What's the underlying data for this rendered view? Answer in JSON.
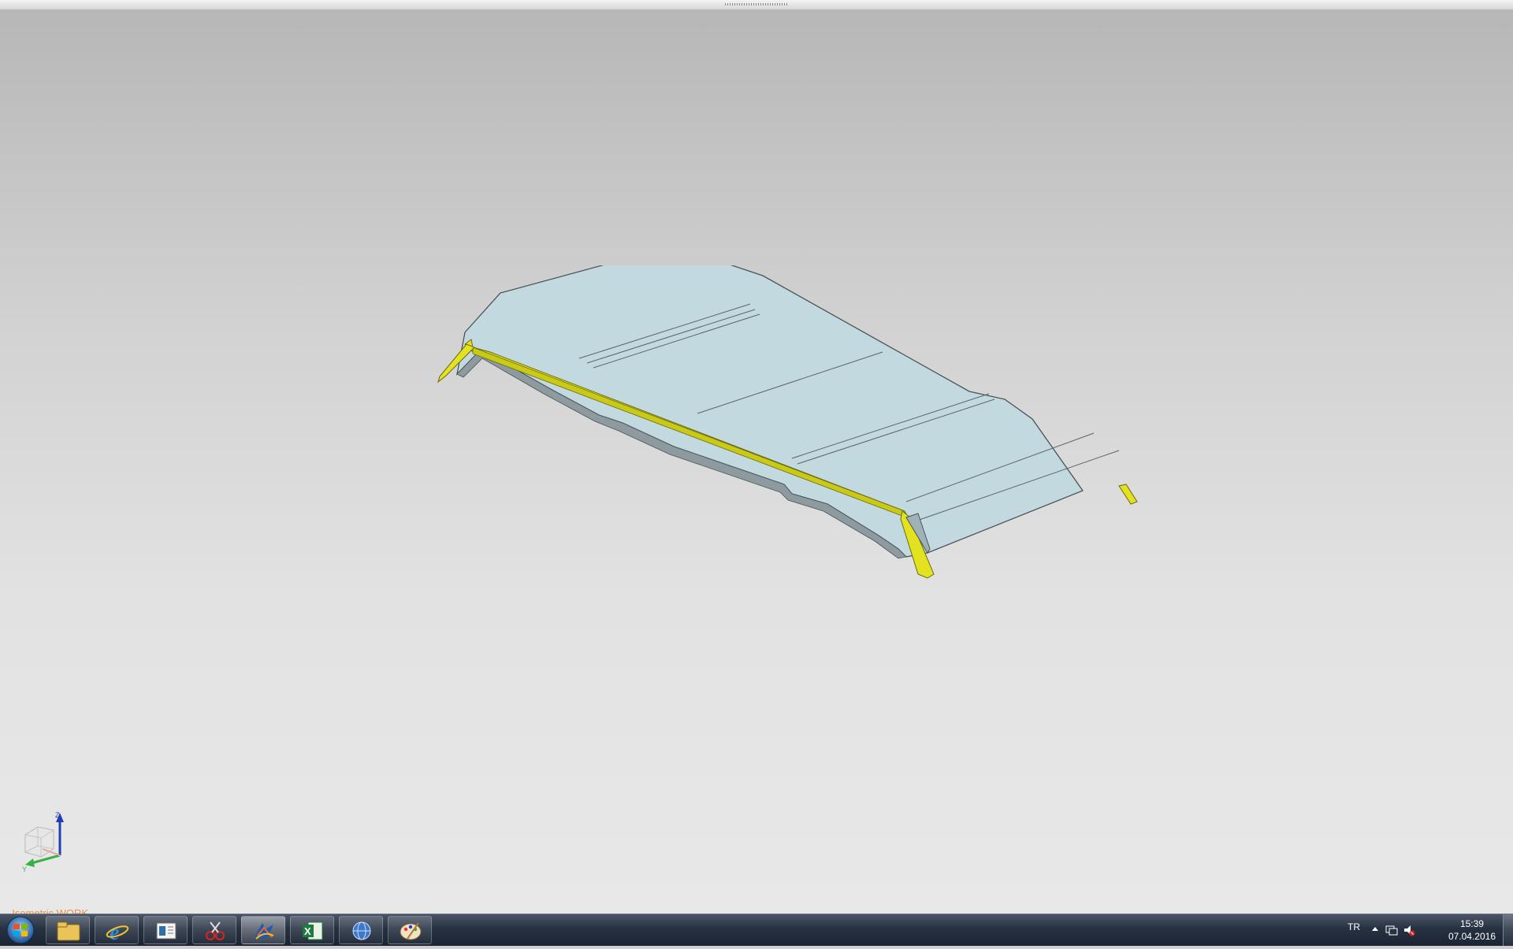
{
  "viewport": {
    "view_label": "_Isometric WORK",
    "triad": {
      "z_label": "Z",
      "y_label": "Y"
    },
    "model_colors": {
      "panel": "#c2d9df",
      "frame": "#e2e221",
      "edge": "#4c5357"
    }
  },
  "taskbar": {
    "apps": [
      {
        "name": "windows-explorer",
        "icon": "folder-icon"
      },
      {
        "name": "internet-explorer",
        "icon": "ie-icon"
      },
      {
        "name": "document-viewer",
        "icon": "window-icon"
      },
      {
        "name": "snipping-tool",
        "icon": "scissors-icon"
      },
      {
        "name": "catia",
        "icon": "catia-icon",
        "active": true
      },
      {
        "name": "excel",
        "icon": "excel-icon"
      },
      {
        "name": "web-browser",
        "icon": "globe-icon"
      },
      {
        "name": "paint",
        "icon": "paint-icon"
      }
    ],
    "tray": {
      "language": "TR",
      "time": "15:39",
      "date": "07.04.2016"
    }
  }
}
